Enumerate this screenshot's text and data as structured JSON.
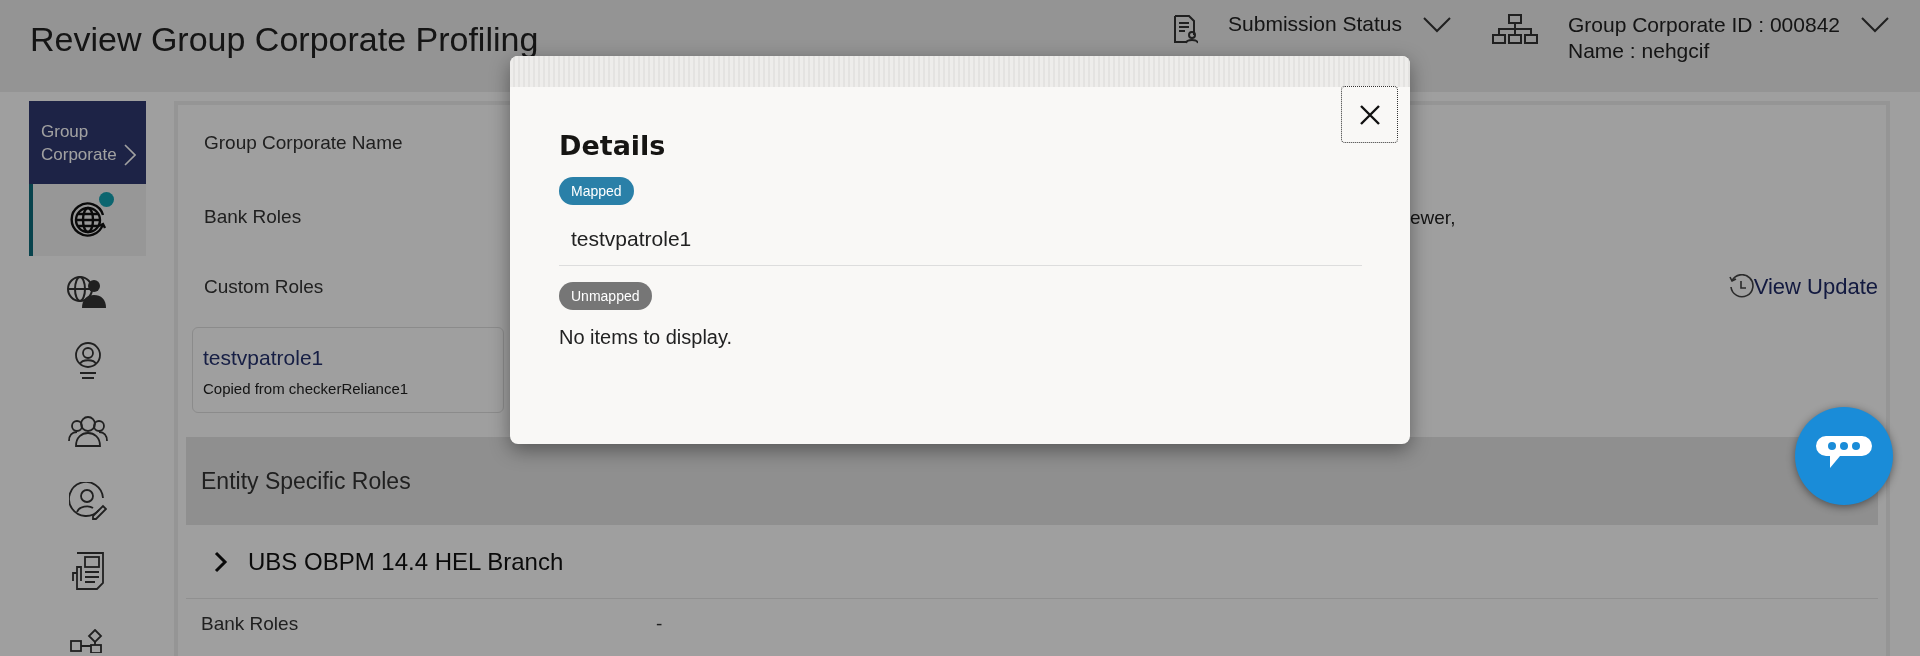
{
  "header": {
    "title": "Review Group Corporate Profiling",
    "submission_status": "Submission Status",
    "corporate_id": "Group Corporate ID : 000842",
    "name": "Name : nehgcif"
  },
  "sidebar": {
    "heading": "Group Corporate",
    "items": [
      {
        "kind": "globe",
        "selected": true,
        "notification": true
      },
      {
        "kind": "globeuser",
        "selected": false,
        "notification": false
      },
      {
        "kind": "profile",
        "selected": false,
        "notification": false
      },
      {
        "kind": "group",
        "selected": false,
        "notification": false
      },
      {
        "kind": "edit",
        "selected": false,
        "notification": false
      },
      {
        "kind": "report",
        "selected": false,
        "notification": false
      },
      {
        "kind": "workflow",
        "selected": false,
        "notification": false
      }
    ]
  },
  "fields": [
    {
      "label": "Group Corporate Name"
    },
    {
      "label": "Bank Roles",
      "value": "ewer,"
    }
  ],
  "custom_roles": {
    "label": "Custom Roles",
    "view_update": "View Update",
    "cards": [
      {
        "name": "testvpatrole1",
        "note": "Copied from checkerReliance1"
      }
    ]
  },
  "entity_roles": {
    "title": "Entity Specific Roles",
    "branches": [
      {
        "name": "UBS OBPM 14.4 HEL Branch",
        "expanded": false
      }
    ],
    "rows": [
      {
        "label": "Bank Roles",
        "value": "-"
      }
    ]
  },
  "modal": {
    "title": "Details",
    "groups": [
      {
        "kind": "mapped",
        "status": "Mapped",
        "items": [
          "testvpatrole1"
        ]
      },
      {
        "kind": "unmapped",
        "status": "Unmapped",
        "empty_text": "No items to display."
      }
    ]
  }
}
